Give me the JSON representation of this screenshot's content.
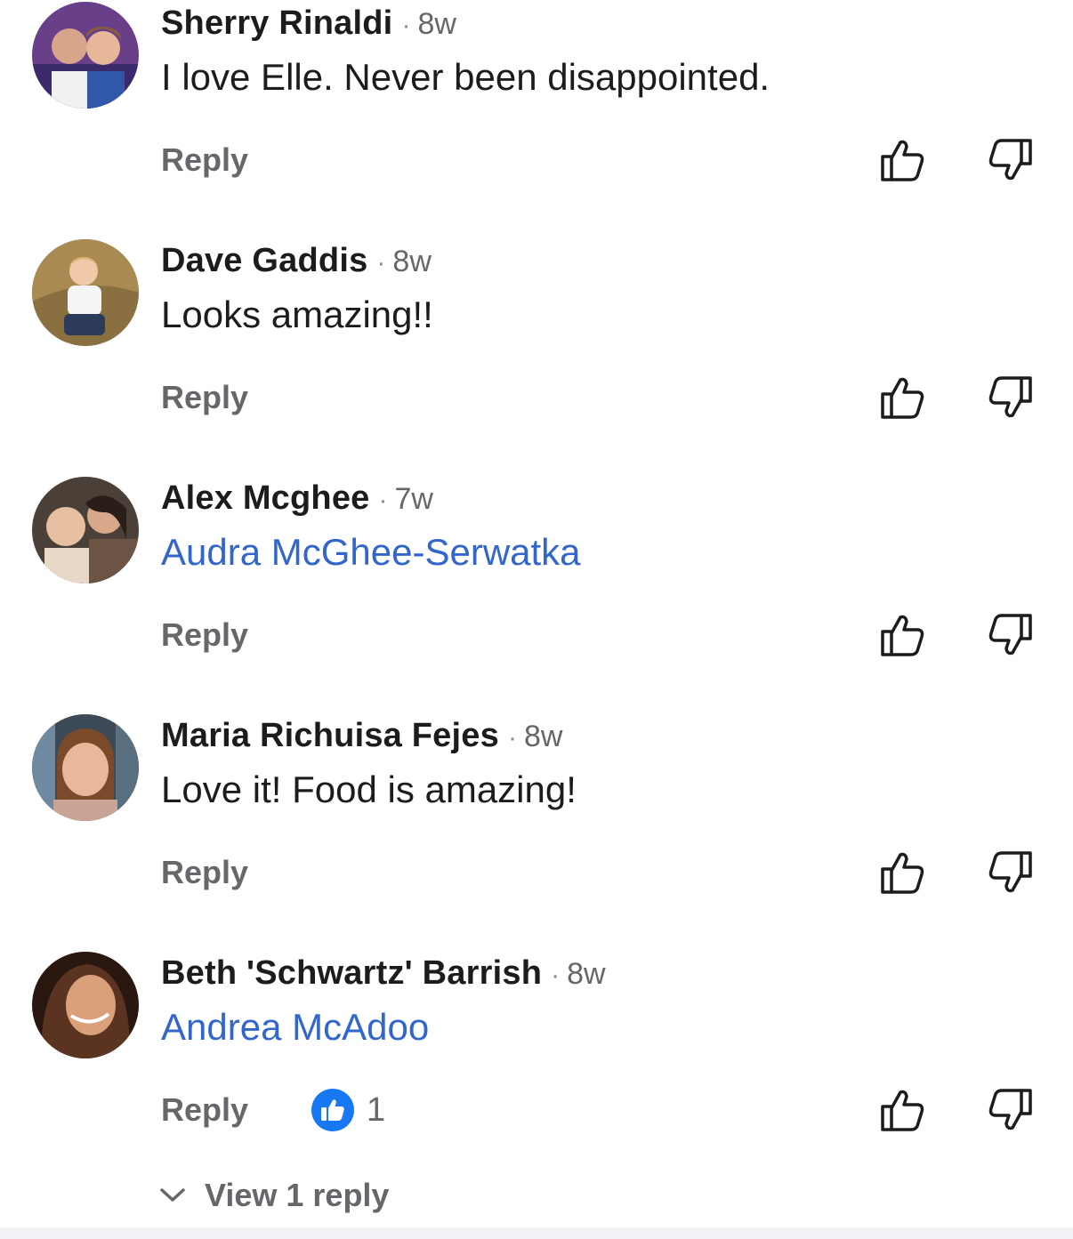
{
  "colors": {
    "name": "#1c1c1e",
    "secondary": "#65676b",
    "mention": "#3366cc",
    "like_badge": "#1877f2"
  },
  "icons": {
    "like": "thumbs-up-outline-icon",
    "dislike": "thumbs-down-outline-icon",
    "reaction": "like-reaction-icon",
    "expand": "chevron-down-icon"
  },
  "comments": [
    {
      "author": "Sherry Rinaldi",
      "separator": "·",
      "time": "8w",
      "text": "I love Elle. Never been disappointed.",
      "is_mention": false,
      "reply_label": "Reply"
    },
    {
      "author": "Dave Gaddis",
      "separator": "·",
      "time": "8w",
      "text": "Looks amazing!!",
      "is_mention": false,
      "reply_label": "Reply"
    },
    {
      "author": "Alex Mcghee",
      "separator": "·",
      "time": "7w",
      "text": "Audra McGhee-Serwatka",
      "is_mention": true,
      "reply_label": "Reply"
    },
    {
      "author": "Maria Richuisa Fejes",
      "separator": "·",
      "time": "8w",
      "text": "Love it! Food is amazing!",
      "is_mention": false,
      "reply_label": "Reply"
    },
    {
      "author": "Beth 'Schwartz' Barrish",
      "separator": "·",
      "time": "8w",
      "text": "Andrea McAdoo",
      "is_mention": true,
      "reply_label": "Reply",
      "reaction_count": "1"
    }
  ],
  "view_replies": {
    "label": "View 1 reply"
  }
}
